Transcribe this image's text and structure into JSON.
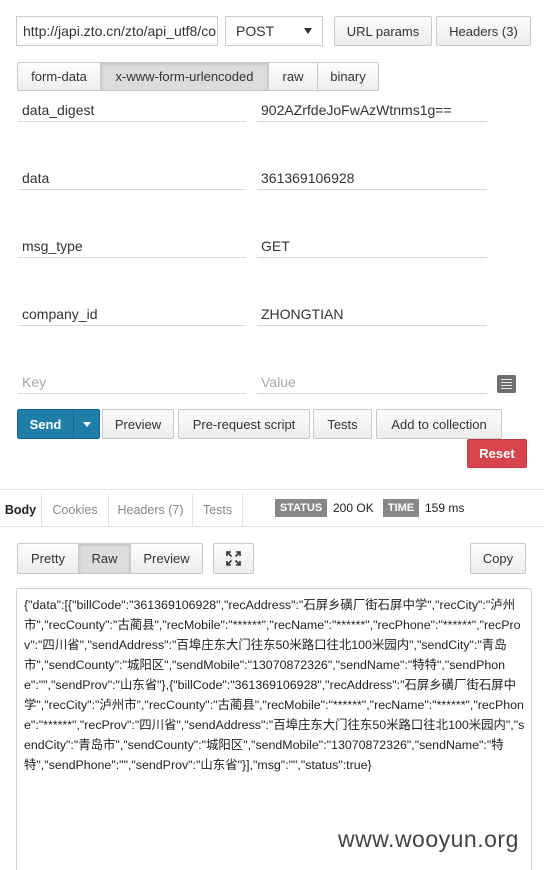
{
  "request": {
    "url": "http://japi.zto.cn/zto/api_utf8/co",
    "method": "POST",
    "url_params_label": "URL params",
    "headers_label": "Headers (3)"
  },
  "body_modes": [
    "form-data",
    "x-www-form-urlencoded",
    "raw",
    "binary"
  ],
  "body_mode_active": "x-www-form-urlencoded",
  "params": [
    {
      "key": "data_digest",
      "value": "902AZrfdeJoFwAzWtnms1g=="
    },
    {
      "key": "data",
      "value": "361369106928"
    },
    {
      "key": "msg_type",
      "value": "GET"
    },
    {
      "key": "company_id",
      "value": "ZHONGTIAN"
    }
  ],
  "new_param": {
    "key_placeholder": "Key",
    "value_placeholder": "Value"
  },
  "actions": {
    "send": "Send",
    "preview": "Preview",
    "prerequest": "Pre-request script",
    "tests": "Tests",
    "add_collection": "Add to collection",
    "reset": "Reset"
  },
  "response": {
    "tabs": [
      "Body",
      "Cookies",
      "Headers (7)",
      "Tests"
    ],
    "status_label": "STATUS",
    "status_value": "200 OK",
    "time_label": "TIME",
    "time_value": "159 ms",
    "view_modes": [
      "Pretty",
      "Raw",
      "Preview"
    ],
    "view_active": "Raw",
    "copy_label": "Copy",
    "body": "{\"data\":[{\"billCode\":\"361369106928\",\"recAddress\":\"石屏乡磺厂街石屏中学\",\"recCity\":\"泸州市\",\"recCounty\":\"古蔺县\",\"recMobile\":\"******\",\"recName\":\"******\",\"recPhone\":\"******\",\"recProv\":\"四川省\",\"sendAddress\":\"百埠庄东大门往东50米路口往北100米园内\",\"sendCity\":\"青岛市\",\"sendCounty\":\"城阳区\",\"sendMobile\":\"13070872326\",\"sendName\":\"特特\",\"sendPhone\":\"\",\"sendProv\":\"山东省\"},{\"billCode\":\"361369106928\",\"recAddress\":\"石屏乡磺厂街石屏中学\",\"recCity\":\"泸州市\",\"recCounty\":\"古蔺县\",\"recMobile\":\"******\",\"recName\":\"******\",\"recPhone\":\"******\",\"recProv\":\"四川省\",\"sendAddress\":\"百埠庄东大门往东50米路口往北100米园内\",\"sendCity\":\"青岛市\",\"sendCounty\":\"城阳区\",\"sendMobile\":\"13070872326\",\"sendName\":\"特特\",\"sendPhone\":\"\",\"sendProv\":\"山东省\"}],\"msg\":\"\",\"status\":true}"
  },
  "watermark": "www.wooyun.org",
  "colors": {
    "send": "#1f7fa8",
    "reset": "#d9434b",
    "badge": "#8a8a8a"
  }
}
